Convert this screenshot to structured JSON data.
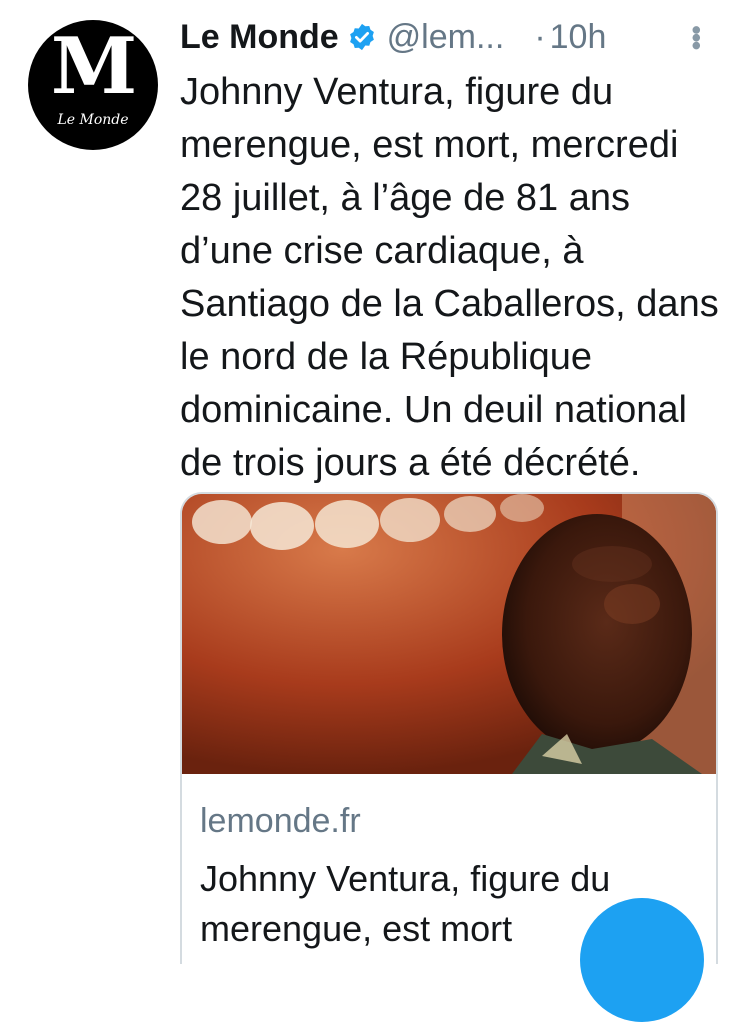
{
  "tweet": {
    "avatar_logo_text": "M",
    "avatar_brand_text": "Le Monde",
    "author_name": "Le Monde",
    "handle": "@lem...",
    "separator": "·",
    "time": "10h",
    "more_icon": "more-vertical-icon",
    "verified_icon": "verified-badge-icon",
    "text": "Johnny Ventura, figure du merengue, est mort, mercredi 28 juillet, à l’âge de 81 ans d’une crise cardiaque, à Santiago de la Caballeros, dans le nord de la République dominicaine. Un deuil national de trois jours a été décrété."
  },
  "link_card": {
    "domain": "lemonde.fr",
    "title": "Johnny Ventura, figure du merengue, est mort"
  },
  "colors": {
    "verified": "#1da1f2",
    "fab": "#1da1f2",
    "muted": "#657786"
  }
}
